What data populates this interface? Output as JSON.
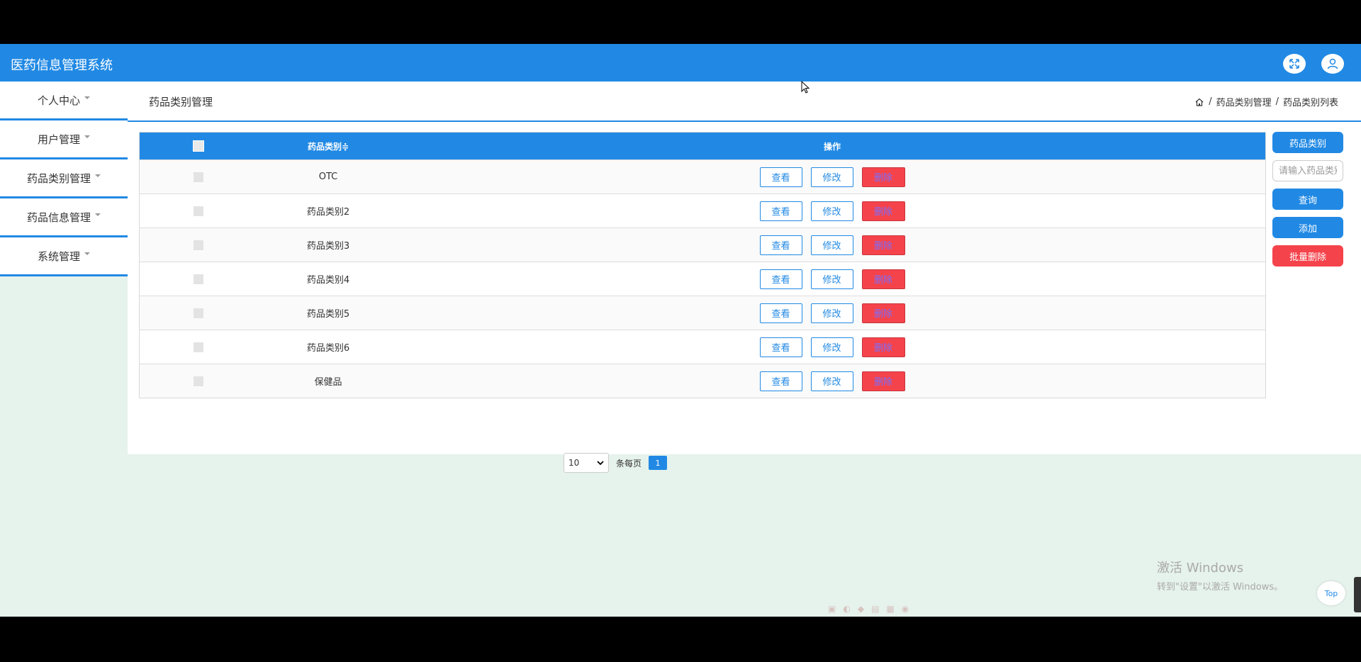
{
  "app": {
    "title": "医药信息管理系统"
  },
  "header_icons": [
    "expand-icon",
    "user-icon"
  ],
  "sidebar": {
    "items": [
      {
        "label": "个人中心"
      },
      {
        "label": "用户管理"
      },
      {
        "label": "药品类别管理"
      },
      {
        "label": "药品信息管理"
      },
      {
        "label": "系统管理"
      }
    ]
  },
  "page": {
    "title": "药品类别管理",
    "breadcrumb": [
      "药品类别管理",
      "药品类别列表"
    ]
  },
  "table": {
    "columns": {
      "name": "药品类别≑",
      "ops": "操作"
    },
    "actions": {
      "view": "查看",
      "edit": "修改",
      "delete": "删除"
    },
    "rows": [
      {
        "name": "OTC"
      },
      {
        "name": "药品类别2"
      },
      {
        "name": "药品类别3"
      },
      {
        "name": "药品类别4"
      },
      {
        "name": "药品类别5"
      },
      {
        "name": "药品类别6"
      },
      {
        "name": "保健品"
      }
    ]
  },
  "pagination": {
    "per_page": "10",
    "per_page_label": "条每页",
    "current_page": "1"
  },
  "search": {
    "label": "药品类别",
    "placeholder": "请输入药品类别",
    "query": "查询",
    "add": "添加",
    "batch_delete": "批量删除"
  },
  "watermark": {
    "line1": "激活 Windows",
    "line2": "转到\"设置\"以激活 Windows。"
  },
  "top_button": "Top",
  "colors": {
    "primary": "#2189e4",
    "danger": "#f5434c",
    "background": "#e6f2ec"
  }
}
